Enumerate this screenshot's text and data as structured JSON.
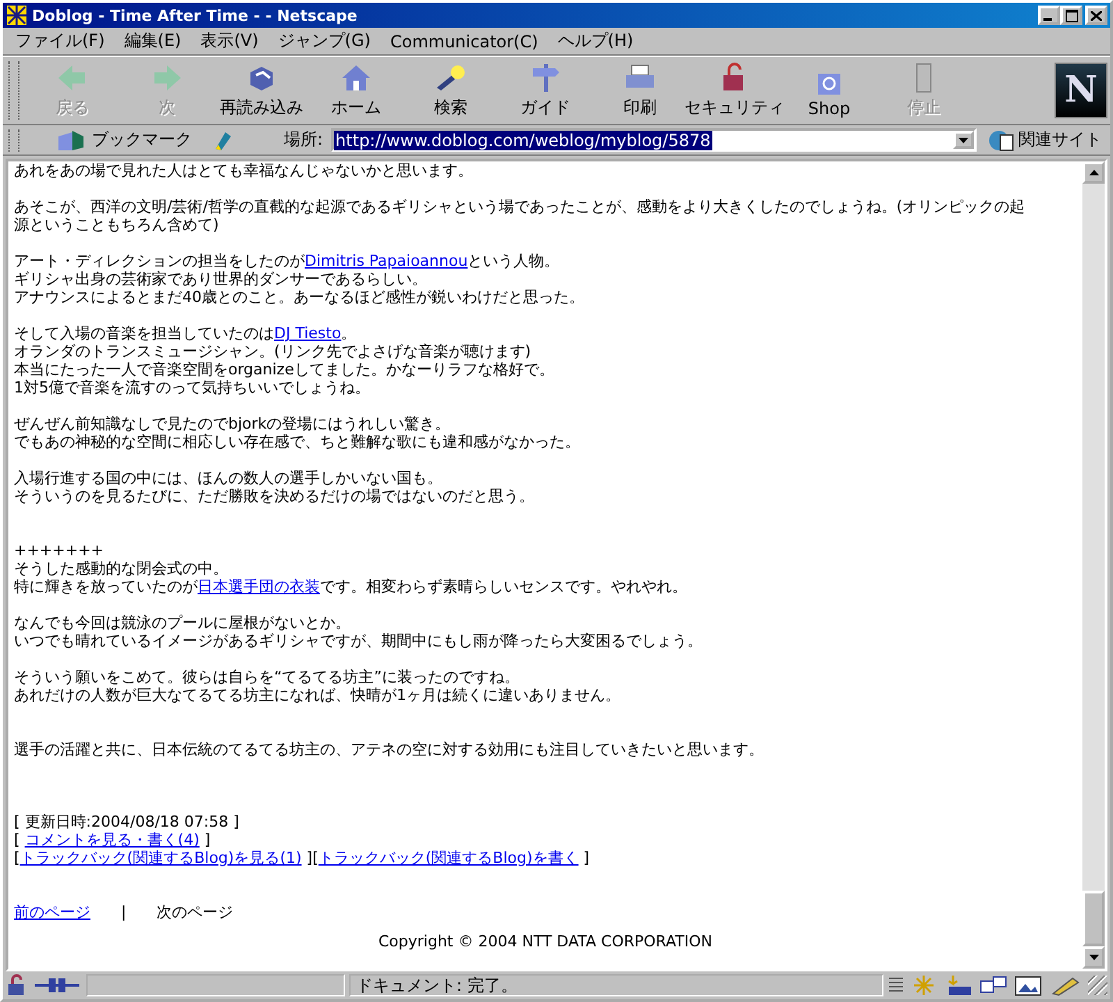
{
  "window": {
    "title": "Doblog - Time After Time - - Netscape"
  },
  "menu": [
    "ファイル(F)",
    "編集(E)",
    "表示(V)",
    "ジャンプ(G)",
    "Communicator(C)",
    "ヘルプ(H)"
  ],
  "toolbar": [
    {
      "label": "戻る",
      "disabled": true
    },
    {
      "label": "次",
      "disabled": true
    },
    {
      "label": "再読み込み",
      "disabled": false
    },
    {
      "label": "ホーム",
      "disabled": false
    },
    {
      "label": "検索",
      "disabled": false
    },
    {
      "label": "ガイド",
      "disabled": false
    },
    {
      "label": "印刷",
      "disabled": false
    },
    {
      "label": "セキュリティ",
      "disabled": false
    },
    {
      "label": "Shop",
      "disabled": false
    },
    {
      "label": "停止",
      "disabled": true
    }
  ],
  "logo": "N",
  "location": {
    "bookmarks": "ブックマーク",
    "label": "場所:",
    "url": "http://www.doblog.com/weblog/myblog/5878",
    "url_selected": true,
    "related": "関連サイト"
  },
  "content": [
    {
      "kind": "para",
      "lines": [
        [
          {
            "text": "あれをあの場で見れた人はとても幸福なんじゃないかと思います。",
            "link": false
          }
        ]
      ]
    },
    {
      "kind": "para",
      "lines": [
        [
          {
            "text": "あそこが、西洋の文明/芸術/哲学の直截的な起源であるギリシャという場であったことが、感動をより大きくしたのでしょうね。(オリンピックの起",
            "link": false
          }
        ],
        [
          {
            "text": "源ということもちろん含めて)",
            "link": false
          }
        ]
      ]
    },
    {
      "kind": "para",
      "lines": [
        [
          {
            "text": "アート・ディレクションの担当をしたのが",
            "link": false
          },
          {
            "text": "Dimitris Papaioannou",
            "link": true
          },
          {
            "text": "という人物。",
            "link": false
          }
        ],
        [
          {
            "text": "ギリシャ出身の芸術家であり世界的ダンサーであるらしい。",
            "link": false
          }
        ],
        [
          {
            "text": "アナウンスによるとまだ40歳とのこと。あーなるほど感性が鋭いわけだと思った。",
            "link": false
          }
        ]
      ]
    },
    {
      "kind": "para",
      "lines": [
        [
          {
            "text": "そして入場の音楽を担当していたのは",
            "link": false
          },
          {
            "text": "DJ  Tiesto",
            "link": true
          },
          {
            "text": "。",
            "link": false
          }
        ],
        [
          {
            "text": "オランダのトランスミュージシャン。(リンク先でよさげな音楽が聴けます)",
            "link": false
          }
        ],
        [
          {
            "text": "本当にたった一人で音楽空間をorganizeしてました。かなーりラフな格好で。",
            "link": false
          }
        ],
        [
          {
            "text": "1対5億で音楽を流すのって気持ちいいでしょうね。",
            "link": false
          }
        ]
      ]
    },
    {
      "kind": "para",
      "lines": [
        [
          {
            "text": "ぜんぜん前知識なしで見たのでbjorkの登場にはうれしい驚き。",
            "link": false
          }
        ],
        [
          {
            "text": "でもあの神秘的な空間に相応しい存在感で、ちと難解な歌にも違和感がなかった。",
            "link": false
          }
        ]
      ]
    },
    {
      "kind": "para",
      "lines": [
        [
          {
            "text": "入場行進する国の中には、ほんの数人の選手しかいない国も。",
            "link": false
          }
        ],
        [
          {
            "text": "そういうのを見るたびに、ただ勝敗を決めるだけの場ではないのだと思う。",
            "link": false
          }
        ]
      ]
    },
    {
      "kind": "break"
    },
    {
      "kind": "para",
      "lines": [
        [
          {
            "text": "+++++++",
            "link": false
          }
        ],
        [
          {
            "text": "そうした感動的な閉会式の中。",
            "link": false
          }
        ],
        [
          {
            "text": "特に輝きを放っていたのが",
            "link": false
          },
          {
            "text": "日本選手団の衣装",
            "link": true
          },
          {
            "text": "です。相変わらず素晴らしいセンスです。やれやれ。",
            "link": false
          }
        ]
      ]
    },
    {
      "kind": "para",
      "lines": [
        [
          {
            "text": "なんでも今回は競泳のプールに屋根がないとか。",
            "link": false
          }
        ],
        [
          {
            "text": "いつでも晴れているイメージがあるギリシャですが、期間中にもし雨が降ったら大変困るでしょう。",
            "link": false
          }
        ]
      ]
    },
    {
      "kind": "para",
      "lines": [
        [
          {
            "text": "そういう願いをこめて。彼らは自らを“てるてる坊主”に装ったのですね。",
            "link": false
          }
        ],
        [
          {
            "text": "あれだけの人数が巨大なてるてる坊主になれば、快晴が1ヶ月は続くに違いありません。",
            "link": false
          }
        ]
      ]
    },
    {
      "kind": "break"
    },
    {
      "kind": "para",
      "lines": [
        [
          {
            "text": "選手の活躍と共に、日本伝統のてるてる坊主の、アテネの空に対する効用にも注目していきたいと思います。",
            "link": false
          }
        ]
      ]
    },
    {
      "kind": "break"
    },
    {
      "kind": "break"
    },
    {
      "kind": "para",
      "lines": [
        [
          {
            "text": "[ 更新日時:2004/08/18 07:58 ]",
            "link": false
          }
        ],
        [
          {
            "text": "[ ",
            "link": false
          },
          {
            "text": "コメントを見る・書く(4)",
            "link": true
          },
          {
            "text": " ]",
            "link": false
          }
        ],
        [
          {
            "text": "[",
            "link": false
          },
          {
            "text": "トラックバック(関連するBlog)を見る(1)",
            "link": true
          },
          {
            "text": " ][",
            "link": false
          },
          {
            "text": "トラックバック(関連するBlog)を書く",
            "link": true
          },
          {
            "text": " ]",
            "link": false
          }
        ]
      ]
    },
    {
      "kind": "break"
    },
    {
      "kind": "para",
      "lines": [
        [
          {
            "text": "前のページ",
            "link": true
          },
          {
            "text": "　　|　　次のページ",
            "link": false
          }
        ]
      ]
    },
    {
      "kind": "center",
      "lines": [
        [
          {
            "text": "Copyright © 2004 NTT DATA CORPORATION",
            "link": false
          }
        ]
      ]
    }
  ],
  "status": {
    "text": "ドキュメント: 完了。"
  }
}
